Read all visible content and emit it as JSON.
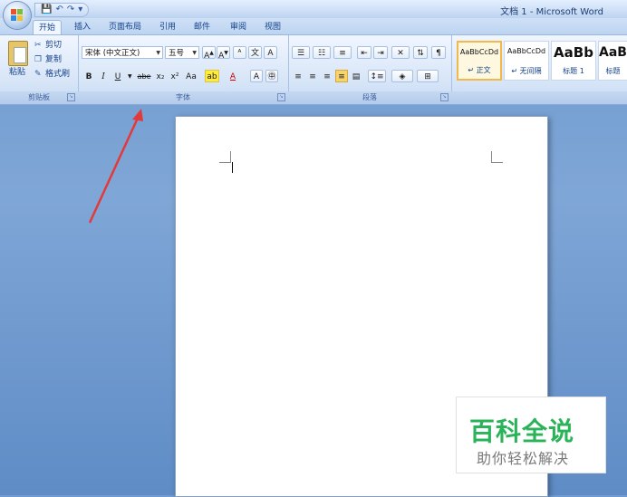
{
  "window": {
    "title": "文档 1 - Microsoft Word"
  },
  "tabs": [
    {
      "label": "开始",
      "active": true
    },
    {
      "label": "插入"
    },
    {
      "label": "页面布局"
    },
    {
      "label": "引用"
    },
    {
      "label": "邮件"
    },
    {
      "label": "审阅"
    },
    {
      "label": "视图"
    }
  ],
  "clipboard": {
    "paste": "粘贴",
    "cut": "剪切",
    "copy": "复制",
    "format_painter": "格式刷",
    "group_label": "剪贴板"
  },
  "font": {
    "font_name": "宋体 (中文正文)",
    "font_size": "五号",
    "group_label": "字体",
    "buttons": [
      "B",
      "I",
      "U",
      "abe",
      "x₂",
      "x²",
      "Aa"
    ]
  },
  "paragraph": {
    "group_label": "段落"
  },
  "styles": [
    {
      "sample": "AaBbCcDd",
      "name": "↵ 正文",
      "selected": true
    },
    {
      "sample": "AaBbCcDd",
      "name": "↵ 无间隔"
    },
    {
      "sample": "AaBb",
      "name": "标题 1"
    },
    {
      "sample": "AaB",
      "name": "标题"
    }
  ],
  "watermark": {
    "title": "百科全说",
    "subtitle": "助你轻松解决"
  },
  "colors": {
    "accent": "#2bb35a",
    "arrow": "#e23a3a"
  }
}
